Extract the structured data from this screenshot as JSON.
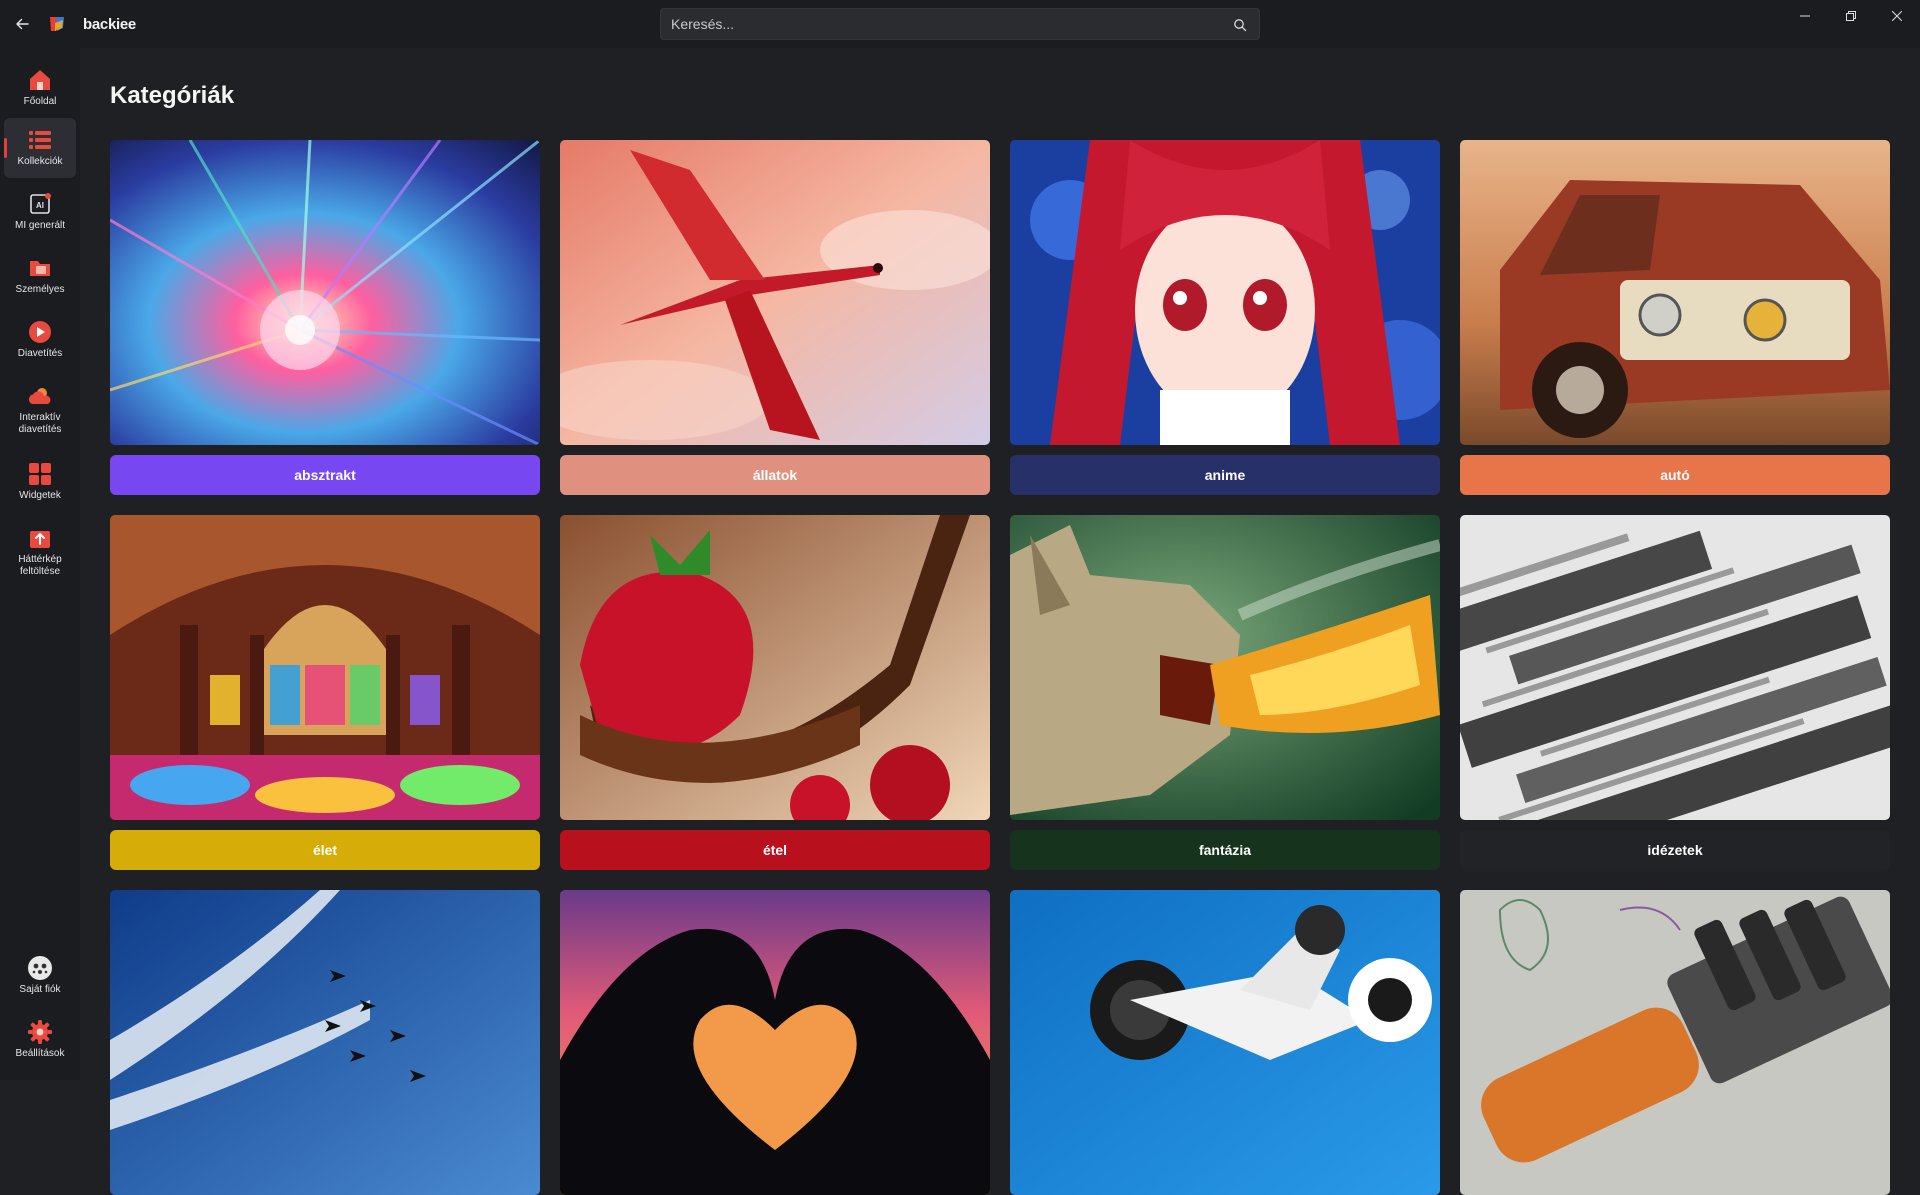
{
  "app": {
    "name": "backiee"
  },
  "search": {
    "placeholder": "Keresés..."
  },
  "sidebar": {
    "items": [
      {
        "label": "Főoldal",
        "icon": "home-icon"
      },
      {
        "label": "Kollekciók",
        "icon": "list-icon",
        "active": true
      },
      {
        "label": "MI generált",
        "icon": "ai-icon"
      },
      {
        "label": "Személyes",
        "icon": "folder-icon"
      },
      {
        "label": "Diavetítés",
        "icon": "play-icon"
      },
      {
        "label": "Interaktív diavetítés",
        "icon": "weather-icon"
      },
      {
        "label": "Widgetek",
        "icon": "widgets-icon"
      },
      {
        "label": "Háttérkép feltöltése",
        "icon": "upload-icon"
      }
    ],
    "bottom": [
      {
        "label": "Saját fiók",
        "icon": "avatar-icon"
      },
      {
        "label": "Beállítások",
        "icon": "gear-icon"
      }
    ]
  },
  "main": {
    "title": "Kategóriák",
    "categories": [
      {
        "label": "absztrakt",
        "color": "#7748f2"
      },
      {
        "label": "állatok",
        "color": "#e0907e"
      },
      {
        "label": "anime",
        "color": "#28306a"
      },
      {
        "label": "autó",
        "color": "#e8744a"
      },
      {
        "label": "élet",
        "color": "#d6ac08"
      },
      {
        "label": "étel",
        "color": "#b8101d"
      },
      {
        "label": "fantázia",
        "color": "#16331e"
      },
      {
        "label": "idézetek",
        "color": "#222327"
      },
      {
        "label": "",
        "color": "#2e5a9a"
      },
      {
        "label": "",
        "color": "#c9546c"
      },
      {
        "label": "",
        "color": "#1c70b4"
      },
      {
        "label": "",
        "color": "#6e6e6e"
      }
    ]
  }
}
